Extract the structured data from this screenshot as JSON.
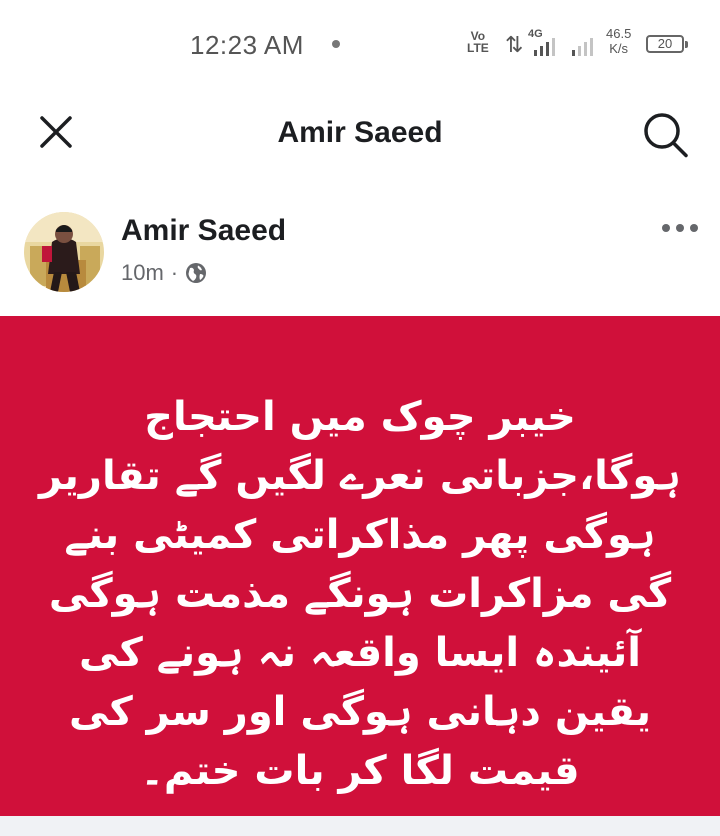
{
  "status_bar": {
    "time": "12:23 AM",
    "volte_top": "Vo",
    "volte_bottom": "LTE",
    "sim1_label": "4G",
    "network_speed_value": "46.5",
    "network_speed_unit": "K/s",
    "battery": "20"
  },
  "header": {
    "title": "Amir Saeed",
    "close_icon": "close-icon",
    "search_icon": "search-icon"
  },
  "post": {
    "author": "Amir Saeed",
    "time_ago": "10m",
    "separator": "·",
    "privacy_icon": "globe-icon",
    "background_color": "#d0103a",
    "text": "خیبر چوک میں احتجاج ہوگا،جزباتی نعرے لگیں گے تقاریر ہوگی پھر مذاکراتی کمیٹی بنے گی مزاکرات ہونگے مذمت ہوگی آئیندہ ایسا واقعہ نہ ہونے کی یقین دہانی ہوگی اور سر کی قیمت لگا کر بات ختم۔"
  }
}
